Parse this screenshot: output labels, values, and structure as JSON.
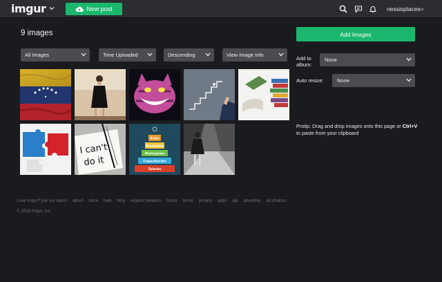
{
  "header": {
    "logo": "imgur",
    "new_post_label": "New post",
    "username": "nessisplaces"
  },
  "main": {
    "image_count": "9 images",
    "filters": [
      {
        "label": "All Images"
      },
      {
        "label": "Time Uploaded"
      },
      {
        "label": "Descending"
      },
      {
        "label": "View Image Info"
      }
    ],
    "thumbnails": [
      {
        "name": "thumb-flag",
        "desc": "venezuela-flag"
      },
      {
        "name": "thumb-woman",
        "desc": "woman-in-black-dress"
      },
      {
        "name": "thumb-cheshire-cat",
        "desc": "cheshire-cat"
      },
      {
        "name": "thumb-stairs",
        "desc": "hand-drawing-stairs"
      },
      {
        "name": "thumb-books",
        "desc": "books-stack"
      },
      {
        "name": "thumb-puzzle",
        "desc": "puzzle-pieces"
      },
      {
        "name": "thumb-cant-do-it",
        "desc": "i-cant-do-it-paper"
      },
      {
        "name": "thumb-pyramid",
        "desc": "success-pyramid"
      },
      {
        "name": "thumb-girl-bw",
        "desc": "girl-black-white"
      }
    ],
    "pyramid_levels": [
      "Éxito",
      "Disciplina",
      "Motivación",
      "Capacitación",
      "Talento"
    ],
    "paper_text": [
      "I can't",
      "do it"
    ]
  },
  "sidebar": {
    "add_images_label": "Add Images",
    "add_to_album_label_1": "Add to",
    "add_to_album_label_2": "album:",
    "album_value": "None",
    "auto_resize_label": "Auto resize:",
    "resize_value": "None",
    "protip_prefix": "Protip: Drag and drop images onto this page or",
    "protip_shortcut": "Ctrl+V",
    "protip_suffix": "to paste from your clipboard"
  },
  "footer": {
    "links": [
      "Love imgur? join our team!",
      "about",
      "store",
      "help",
      "blog",
      "request deletion",
      "forum",
      "terms",
      "privacy",
      "apps",
      "api",
      "advertise",
      "ad choices"
    ],
    "separator": "·",
    "copyright": "© 2018 Imgur, Inc."
  },
  "colors": {
    "accent": "#1bb76e",
    "background": "#1a1b1e",
    "topbar": "#2b2d31",
    "select": "#4a4c52"
  },
  "icons": {
    "logo_caret": "chevron-down-icon",
    "new_post": "cloud-upload-icon",
    "search": "search-icon",
    "messages": "chat-icon",
    "notifications": "bell-icon",
    "user_caret": "chevron-down-icon",
    "select": "chevron-down-icon"
  }
}
